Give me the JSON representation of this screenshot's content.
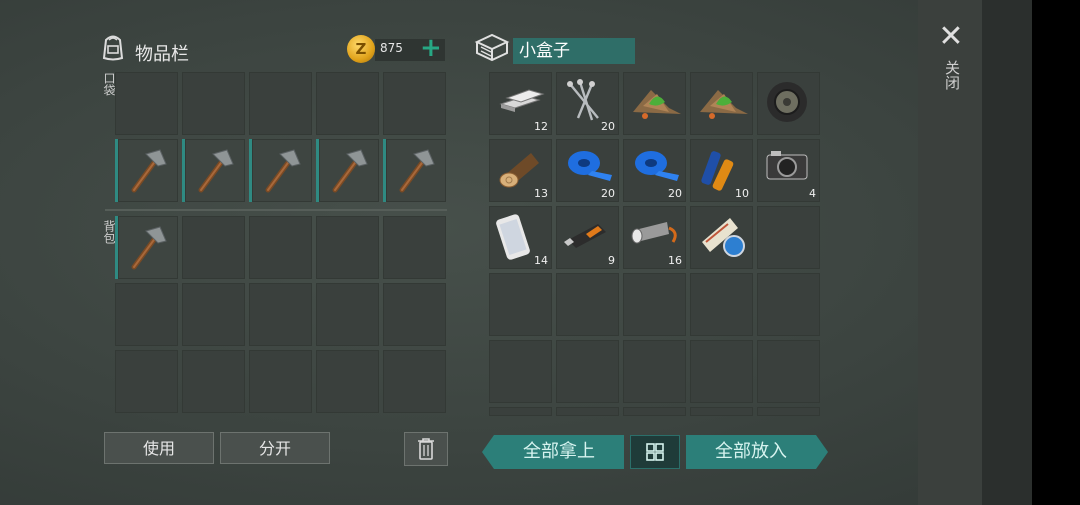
{
  "inventory": {
    "title": "物品栏",
    "coins": "875",
    "coin_symbol": "Z",
    "pocket_label": "口袋",
    "backpack_label": "背包",
    "pockets_row2": [
      "pickaxe-icon",
      "pickaxe-icon",
      "pickaxe-icon",
      "pickaxe-icon",
      "pickaxe-icon"
    ],
    "backpack_first": "pickaxe-icon",
    "use_label": "使用",
    "split_label": "分开"
  },
  "container": {
    "name": "小盒子",
    "items": [
      {
        "icon": "metal-ingots-icon",
        "count": "12"
      },
      {
        "icon": "nails-icon",
        "count": "20"
      },
      {
        "icon": "herb-pile-icon",
        "count": ""
      },
      {
        "icon": "herb-pile-icon",
        "count": ""
      },
      {
        "icon": "tire-icon",
        "count": ""
      },
      {
        "icon": "wood-log-icon",
        "count": "13"
      },
      {
        "icon": "blue-tape-icon",
        "count": "20"
      },
      {
        "icon": "blue-tape-icon",
        "count": "20"
      },
      {
        "icon": "battery-icon",
        "count": "10"
      },
      {
        "icon": "camera-icon",
        "count": "4"
      },
      {
        "icon": "smartphone-icon",
        "count": "14"
      },
      {
        "icon": "usb-drive-icon",
        "count": "9"
      },
      {
        "icon": "flashlight-icon",
        "count": "16"
      },
      {
        "icon": "map-roll-icon",
        "count": ""
      }
    ],
    "take_all_label": "全部拿上",
    "put_all_label": "全部放入"
  },
  "close_label": "关闭",
  "colors": {
    "accent": "#2c7f79",
    "slot": "#3a403d",
    "coin": "#e0a21a"
  }
}
